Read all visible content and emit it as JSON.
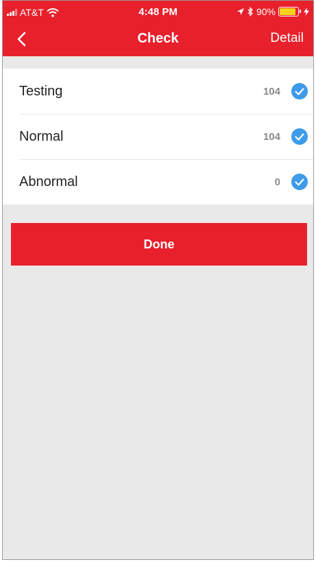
{
  "status_bar": {
    "carrier": "AT&T",
    "time": "4:48 PM",
    "battery_percent": "90%",
    "battery_level": 0.9,
    "icons": [
      "signal-icon",
      "wifi-icon",
      "location-arrow-icon",
      "bluetooth-icon",
      "battery-icon",
      "charging-bolt-icon"
    ]
  },
  "nav": {
    "back_icon": "chevron-left-icon",
    "title": "Check",
    "detail_label": "Detail"
  },
  "items": [
    {
      "label": "Testing",
      "count": "104",
      "checked": true
    },
    {
      "label": "Normal",
      "count": "104",
      "checked": true
    },
    {
      "label": "Abnormal",
      "count": "0",
      "checked": true
    }
  ],
  "done_label": "Done",
  "colors": {
    "accent": "#e8202c",
    "check": "#3d9be9",
    "background": "#e9e9e9",
    "battery": "#f6d31b"
  }
}
